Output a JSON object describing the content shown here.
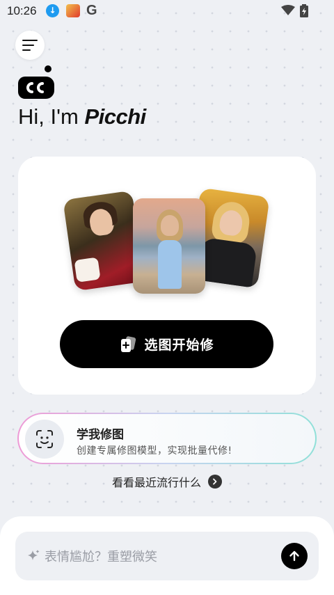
{
  "status_bar": {
    "time": "10:26",
    "icons": [
      "download-icon",
      "app-icon",
      "google-icon",
      "wifi-icon",
      "battery-icon"
    ]
  },
  "header": {
    "menu_icon": "hamburger-icon",
    "logo": "cc-logo",
    "greeting_prefix": "Hi, I'm ",
    "brand": "Picchi"
  },
  "main_card": {
    "photos": [
      "birthday-photo",
      "beach-photo",
      "autumn-photo"
    ],
    "pick_button_label": "选图开始修",
    "pick_button_icon": "add-photo-icon"
  },
  "learn_card": {
    "icon": "face-scan-icon",
    "title": "学我修图",
    "subtitle": "创建专属修图模型，实现批量代修!"
  },
  "trending": {
    "label": "看看最近流行什么",
    "icon": "chevron-right-icon"
  },
  "input": {
    "placeholder": "表情尴尬？重塑微笑",
    "sparkle_icon": "sparkle-icon",
    "send_icon": "send-arrow-icon"
  },
  "colors": {
    "background": "#eef0f4",
    "card": "#ffffff",
    "primary_button": "#000000",
    "accent_download": "#1e9bf0"
  }
}
